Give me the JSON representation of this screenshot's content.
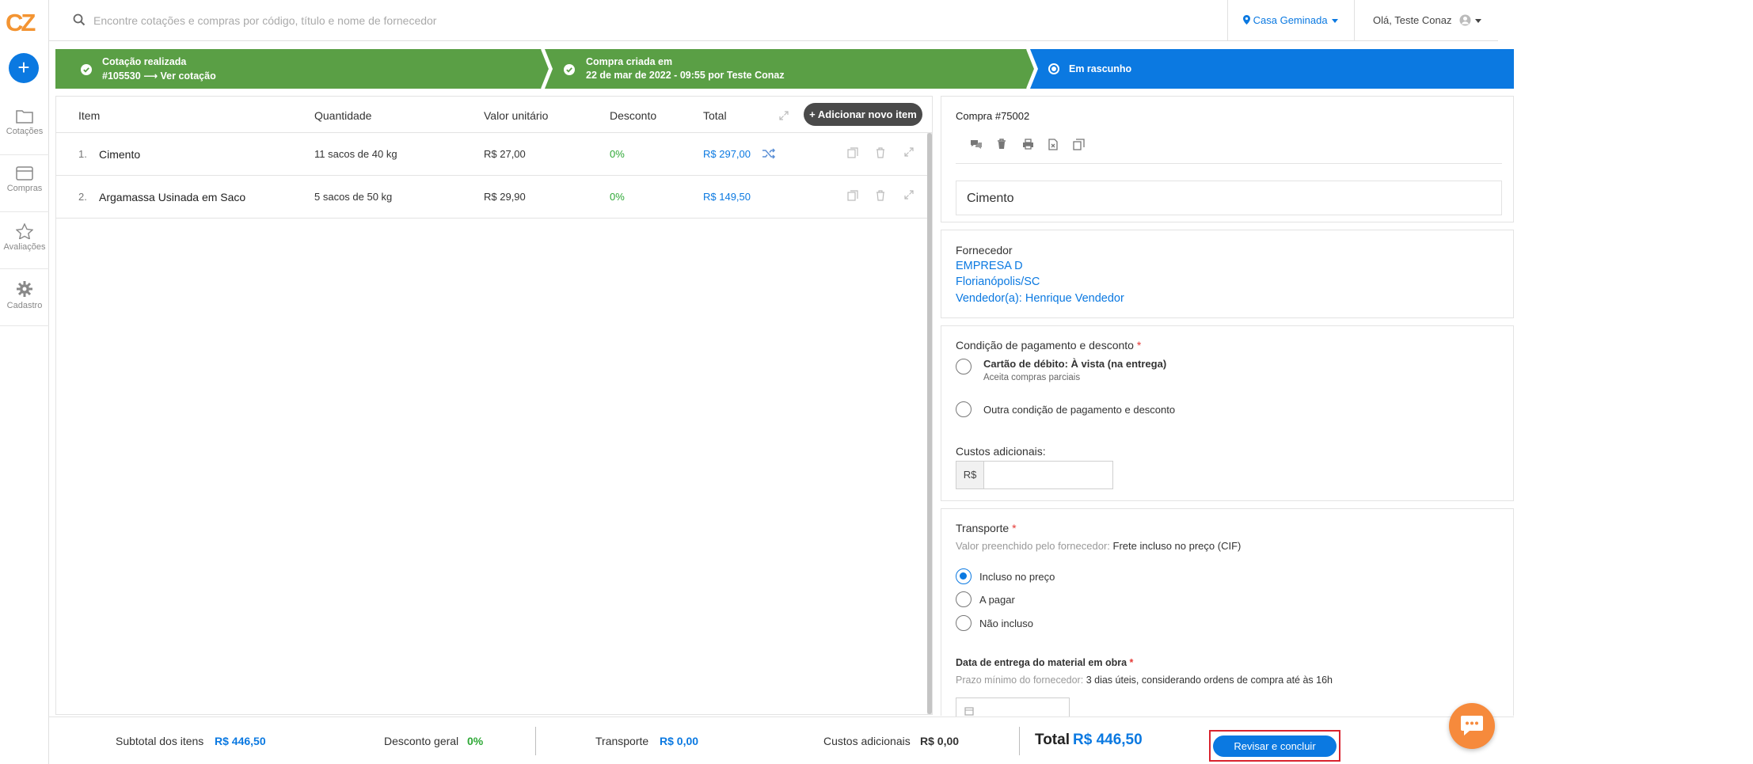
{
  "logo": "CZ",
  "search": {
    "placeholder": "Encontre cotações e compras por código, título e nome de fornecedor"
  },
  "header": {
    "location": "Casa Geminada",
    "greeting": "Olá, Teste Conaz"
  },
  "sidebar": {
    "plus": "+",
    "items": [
      {
        "label": "Cotações",
        "icon": "folder-icon"
      },
      {
        "label": "Compras",
        "icon": "card-icon"
      },
      {
        "label": "Avaliações",
        "icon": "star-icon"
      },
      {
        "label": "Cadastro",
        "icon": "gear-icon"
      }
    ]
  },
  "stepper": {
    "step1": {
      "line1": "Cotação realizada",
      "line2": "#105530 ⟶ Ver cotação"
    },
    "step2": {
      "line1": "Compra criada em",
      "line2": "22 de mar de 2022 - 09:55 por Teste Conaz"
    },
    "step3": {
      "line1": "Em rascunho"
    },
    "colors": {
      "done": "#5a9f45",
      "active": "#0b79e1"
    }
  },
  "table": {
    "headers": {
      "item": "Item",
      "quantity": "Quantidade",
      "unit_value": "Valor unitário",
      "discount": "Desconto",
      "total": "Total"
    },
    "add_button": "+ Adicionar novo item",
    "rows": [
      {
        "num": "1.",
        "name": "Cimento",
        "quantity": "11 sacos de 40 kg",
        "unit_value": "R$ 27,00",
        "discount": "0%",
        "total": "R$ 297,00"
      },
      {
        "num": "2.",
        "name": "Argamassa Usinada em Saco",
        "quantity": "5 sacos de 50 kg",
        "unit_value": "R$ 29,90",
        "discount": "0%",
        "total": "R$ 149,50"
      }
    ]
  },
  "purchase": {
    "title": "Compra #75002",
    "item_name": "Cimento"
  },
  "supplier": {
    "label": "Fornecedor",
    "name": "EMPRESA D",
    "city": "Florianópolis/SC",
    "seller": "Vendedor(a): Henrique Vendedor"
  },
  "payment": {
    "label": "Condição de pagamento e desconto",
    "required": "*",
    "option1_title": "Cartão de débito: À vista (na entrega)",
    "option1_sub": "Aceita compras parciais",
    "option2": "Outra condição de pagamento e desconto",
    "extra_costs_label": "Custos adicionais:",
    "currency_prefix": "R$"
  },
  "transport": {
    "label": "Transporte",
    "required": "*",
    "prefilled_label": "Valor preenchido pelo fornecedor:",
    "prefilled_value": "Frete incluso no preço (CIF)",
    "options": [
      "Incluso no preço",
      "A pagar",
      "Não incluso"
    ],
    "selected": 0,
    "delivery_label": "Data de entrega do material em obra",
    "min_label": "Prazo mínimo do fornecedor:",
    "min_value": "3 dias úteis, considerando ordens de compra até às 16h"
  },
  "footer": {
    "subtotal_label": "Subtotal dos itens",
    "subtotal_value": "R$ 446,50",
    "discount_label": "Desconto geral",
    "discount_value": "0%",
    "transport_label": "Transporte",
    "transport_value": "R$ 0,00",
    "extra_label": "Custos adicionais",
    "extra_value": "R$ 0,00",
    "total_label": "Total",
    "total_value": "R$ 446,50",
    "review_button": "Revisar e concluir"
  }
}
